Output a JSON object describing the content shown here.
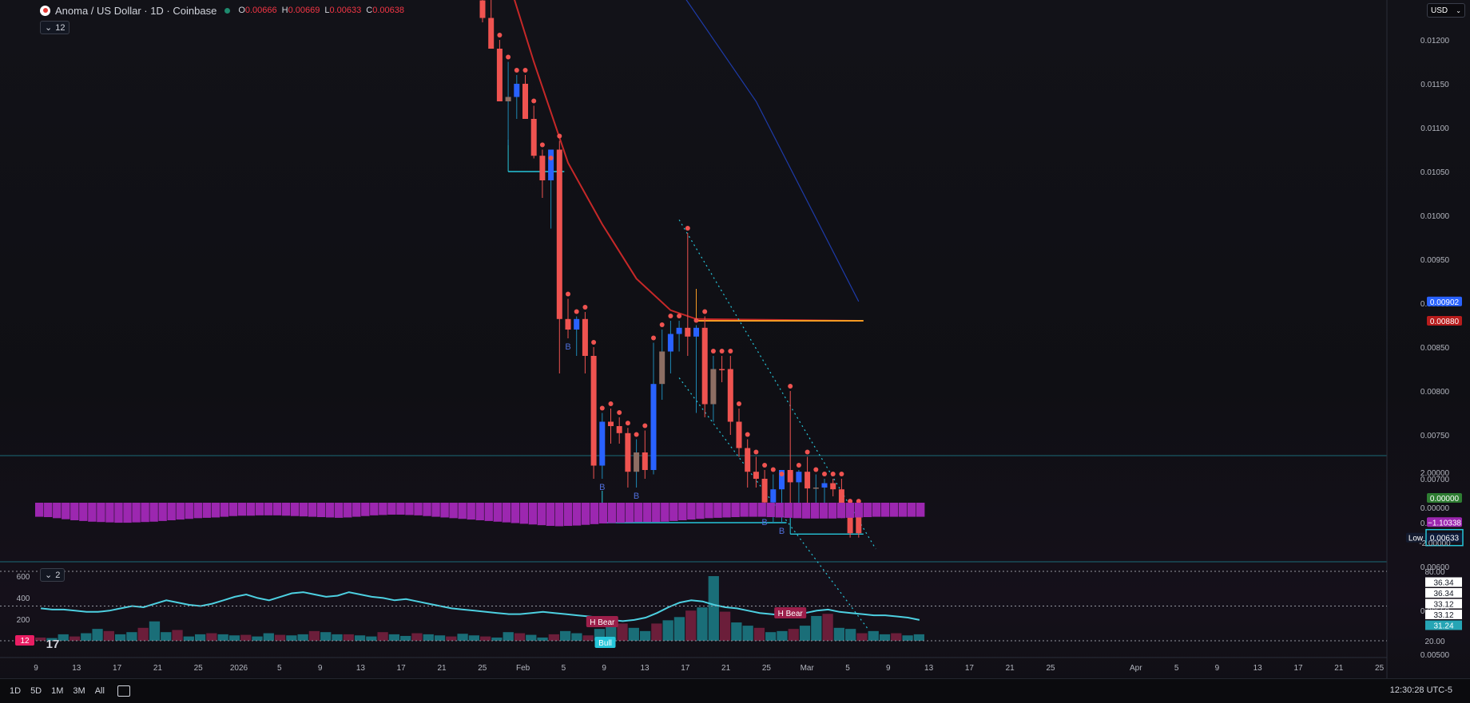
{
  "header": {
    "symbol": "Anoma / US Dollar · 1D · Coinbase",
    "ohlc": {
      "o_label": "O",
      "o": "0.00666",
      "h_label": "H",
      "h": "0.00669",
      "l_label": "L",
      "l": "0.00633",
      "c_label": "C",
      "c": "0.00638"
    },
    "indicator_count": "12",
    "volume_indicator_count": "2",
    "currency": "USD"
  },
  "colors": {
    "up": "#ef5350",
    "down": "#ef5350",
    "bull_fill": "#2962ff",
    "ema_red": "#c62828",
    "sma_blue": "#1e3ba8",
    "cyan": "#26c6da",
    "orange": "#f59a23",
    "hist": "#9c27b0",
    "vol_teal": "#1a6e78",
    "vol_red": "#6b1e3a"
  },
  "chart_data": [
    {
      "type": "line",
      "title": "",
      "series": [
        {
          "name": "",
          "kind": "candles",
          "x": [
            "Jan 22",
            "Jan 23",
            "Jan 24",
            "Jan 25",
            "Jan 26",
            "Jan 27",
            "Jan 28",
            "Jan 29",
            "Jan 30",
            "Jan 31",
            "Feb 1",
            "Feb 2",
            "Feb 3",
            "Feb 4",
            "Feb 5",
            "Feb 6",
            "Feb 7",
            "Feb 8",
            "Feb 9",
            "Feb 10",
            "Feb 11",
            "Feb 12",
            "Feb 13",
            "Feb 14",
            "Feb 15",
            "Feb 16",
            "Feb 17",
            "Feb 18",
            "Feb 19",
            "Feb 20",
            "Feb 21",
            "Feb 22",
            "Feb 23",
            "Feb 24",
            "Feb 25",
            "Feb 26",
            "Feb 27",
            "Feb 28",
            "Mar 1",
            "Mar 2",
            "Mar 3",
            "Mar 4",
            "Mar 5",
            "Mar 6",
            "Mar 7"
          ],
          "open": [
            0.01245,
            0.01225,
            0.0119,
            0.0113,
            0.01135,
            0.0115,
            0.0111,
            0.01068,
            0.0104,
            0.01075,
            0.00882,
            0.0087,
            0.00882,
            0.0084,
            0.00715,
            0.00765,
            0.0076,
            0.00752,
            0.00708,
            0.0073,
            0.0071,
            0.00808,
            0.00845,
            0.00865,
            0.00872,
            0.00862,
            0.00872,
            0.00785,
            0.00825,
            0.00825,
            0.00765,
            0.00735,
            0.00708,
            0.007,
            0.00673,
            0.00688,
            0.0071,
            0.00696,
            0.00708,
            0.00689,
            0.0069,
            0.00695,
            0.00688,
            0.00666,
            0.00666
          ],
          "high": [
            0.01265,
            0.0125,
            0.012,
            0.01175,
            0.0116,
            0.0116,
            0.01125,
            0.01075,
            0.0106,
            0.01085,
            0.00905,
            0.00885,
            0.0089,
            0.0085,
            0.00775,
            0.0078,
            0.0077,
            0.00758,
            0.00745,
            0.00755,
            0.00855,
            0.0087,
            0.0088,
            0.0088,
            0.0098,
            0.00875,
            0.00885,
            0.0084,
            0.0084,
            0.0084,
            0.0078,
            0.00745,
            0.00725,
            0.0071,
            0.00705,
            0.007,
            0.008,
            0.0071,
            0.00725,
            0.00705,
            0.007,
            0.007,
            0.007,
            0.00669,
            0.00669
          ],
          "low": [
            0.0122,
            0.01195,
            0.01135,
            0.0108,
            0.0111,
            0.0112,
            0.01065,
            0.0102,
            0.00985,
            0.0082,
            0.0086,
            0.0084,
            0.0082,
            0.007,
            0.007,
            0.0074,
            0.0074,
            0.0069,
            0.0069,
            0.007,
            0.00705,
            0.0079,
            0.0082,
            0.00845,
            0.0084,
            0.00775,
            0.0077,
            0.00765,
            0.0081,
            0.0075,
            0.00725,
            0.0069,
            0.0069,
            0.0066,
            0.0065,
            0.0065,
            0.00672,
            0.0067,
            0.0066,
            0.00655,
            0.0067,
            0.0068,
            0.00655,
            0.00633,
            0.00633
          ],
          "close": [
            0.01225,
            0.0119,
            0.0113,
            0.01135,
            0.0115,
            0.0111,
            0.01068,
            0.0104,
            0.01075,
            0.00882,
            0.0087,
            0.00882,
            0.0084,
            0.00715,
            0.00765,
            0.0076,
            0.00752,
            0.00708,
            0.0073,
            0.0071,
            0.00808,
            0.00845,
            0.00865,
            0.00872,
            0.00862,
            0.00872,
            0.00785,
            0.00825,
            0.00825,
            0.00765,
            0.00735,
            0.00708,
            0.007,
            0.00673,
            0.00688,
            0.0071,
            0.00696,
            0.00708,
            0.00689,
            0.0069,
            0.00695,
            0.00688,
            0.00666,
            0.00638,
            0.00638
          ]
        },
        {
          "name": "",
          "kind": "ema",
          "points": [
            [
              "Jan 24",
              0.013
            ],
            [
              "Jan 28",
              0.01175
            ],
            [
              "Feb 1",
              0.0106
            ],
            [
              "Feb 5",
              0.0099
            ],
            [
              "Feb 9",
              0.00928
            ],
            [
              "Feb 13",
              0.00892
            ],
            [
              "Feb 16",
              0.00882
            ],
            [
              "Mar 7",
              0.0088
            ]
          ]
        },
        {
          "name": "",
          "kind": "sma",
          "points": [
            [
              "Feb 11",
              0.013
            ],
            [
              "Feb 23",
              0.0113
            ],
            [
              "Mar 7",
              0.00902
            ]
          ]
        }
      ],
      "price_axis": [
        "0.01200",
        "0.01150",
        "0.01100",
        "0.01050",
        "0.01000",
        "0.00950",
        "0.00900",
        "0.00850",
        "0.00800",
        "0.00750",
        "0.00700",
        "0.00650",
        "0.00600",
        "0.00550",
        "0.00500"
      ],
      "price_tags": [
        {
          "value": "0.00902",
          "color": "#2962ff"
        },
        {
          "value": "0.00880",
          "color": "#b71c1c"
        },
        {
          "value": "0.00633",
          "color": "#0d1b3a",
          "label": "Low"
        }
      ],
      "signals": [
        {
          "x": "Feb 1",
          "text": "B"
        },
        {
          "x": "Feb 5",
          "text": "B"
        },
        {
          "x": "Feb 9",
          "text": "B"
        },
        {
          "x": "Feb 24",
          "text": "B"
        },
        {
          "x": "Feb 26",
          "text": "B"
        }
      ],
      "levels": [
        {
          "from": "Jan 25",
          "to": "Jan 31",
          "y": 0.0105,
          "color": "#26c6da"
        },
        {
          "from": "Feb 5",
          "to": "Feb 26",
          "y": 0.0065,
          "color": "#26c6da"
        },
        {
          "from": "Feb 27",
          "to": "Mar 7",
          "y": 0.00637,
          "color": "#26c6da"
        },
        {
          "from": "Feb 16",
          "to": "Mar 7",
          "y": 0.0088,
          "color": "#f59a23"
        }
      ],
      "channel": {
        "upper": [
          [
            "Feb 14",
            0.00995
          ],
          [
            "Mar 9",
            0.0062
          ]
        ],
        "lower": [
          [
            "Feb 14",
            0.00815
          ],
          [
            "Mar 8",
            0.0053
          ]
        ]
      }
    },
    {
      "type": "bar",
      "title": "",
      "yaxis": [
        "2.00000",
        "0.00000",
        "-2.00000"
      ],
      "tags": [
        {
          "value": "0.00000",
          "color": "#2e7d32"
        },
        {
          "value": "−1.10338",
          "color": "#9c27b0"
        }
      ],
      "values": [
        -0.8,
        -0.82,
        -0.88,
        -0.94,
        -1.0,
        -1.04,
        -1.08,
        -1.1,
        -1.12,
        -1.14,
        -1.14,
        -1.12,
        -1.1,
        -1.08,
        -1.04,
        -1.0,
        -0.96,
        -0.92,
        -0.88,
        -0.86,
        -0.84,
        -0.8,
        -0.76,
        -0.74,
        -0.74,
        -0.72,
        -0.72,
        -0.72,
        -0.74,
        -0.76,
        -0.78,
        -0.8,
        -0.82,
        -0.84,
        -0.86,
        -0.84,
        -0.8,
        -0.76,
        -0.72,
        -0.7,
        -0.68,
        -0.68,
        -0.7,
        -0.72,
        -0.76,
        -0.8,
        -0.84,
        -0.88,
        -0.92,
        -0.96,
        -1.0,
        -1.04,
        -1.08,
        -1.12,
        -1.16,
        -1.2,
        -1.24,
        -1.28,
        -1.32,
        -1.34,
        -1.32,
        -1.3,
        -1.26,
        -1.22,
        -1.18,
        -1.16,
        -1.14,
        -1.12,
        -1.1,
        -1.1,
        -1.1,
        -1.08,
        -1.04,
        -1.0,
        -0.96,
        -0.92,
        -0.88,
        -0.86,
        -0.84,
        -0.82,
        -0.8,
        -0.8,
        -0.8,
        -0.82,
        -0.84,
        -0.86,
        -0.88,
        -0.9,
        -0.9,
        -0.9,
        -0.9,
        -0.88,
        -0.86,
        -0.84,
        -0.82,
        -0.8,
        -0.8,
        -0.8,
        -0.8,
        -0.8,
        -0.8
      ]
    },
    {
      "type": "bar",
      "title": "",
      "left_axis": [
        "600",
        "400",
        "200"
      ],
      "right_axis": [
        "80.00",
        "36.34",
        "36.34",
        "33.12",
        "33.12",
        "31.24",
        "20.00"
      ],
      "labels": [
        {
          "x": "Feb 5",
          "text": "H Bear"
        },
        {
          "x": "Feb 6",
          "text": "Bull"
        },
        {
          "x": "Feb 27",
          "text": "H Bear"
        }
      ],
      "volume": [
        30,
        25,
        60,
        40,
        70,
        110,
        90,
        60,
        80,
        120,
        180,
        80,
        100,
        40,
        60,
        70,
        60,
        50,
        55,
        40,
        70,
        55,
        50,
        60,
        90,
        80,
        60,
        60,
        50,
        40,
        80,
        60,
        45,
        70,
        60,
        50,
        40,
        65,
        50,
        40,
        30,
        80,
        70,
        55,
        30,
        60,
        90,
        70,
        50,
        110,
        140,
        160,
        120,
        90,
        160,
        190,
        220,
        280,
        310,
        600,
        270,
        170,
        140,
        120,
        80,
        90,
        110,
        140,
        230,
        250,
        120,
        110,
        70,
        90,
        60,
        70,
        50,
        60
      ],
      "rsi": [
        48,
        47,
        47,
        46,
        45,
        45,
        46,
        48,
        50,
        49,
        52,
        55,
        53,
        51,
        50,
        52,
        55,
        58,
        60,
        57,
        55,
        58,
        61,
        62,
        60,
        58,
        59,
        62,
        60,
        58,
        57,
        55,
        56,
        54,
        52,
        50,
        48,
        47,
        46,
        45,
        44,
        43,
        43,
        44,
        45,
        44,
        43,
        42,
        41,
        40,
        38,
        37,
        38,
        40,
        44,
        49,
        53,
        55,
        54,
        51,
        49,
        48,
        46,
        44,
        43,
        42,
        42,
        44,
        46,
        47,
        45,
        44,
        43,
        42,
        42,
        41,
        40,
        38
      ],
      "channels": [
        "80.00",
        "20.00"
      ]
    }
  ],
  "xaxis": {
    "ticks": [
      "9",
      "13",
      "17",
      "21",
      "25",
      "2026",
      "5",
      "9",
      "13",
      "17",
      "21",
      "25",
      "Feb",
      "5",
      "9",
      "13",
      "17",
      "21",
      "25",
      "Mar",
      "5",
      "9",
      "13",
      "17",
      "21",
      "25",
      "Apr",
      "5",
      "9",
      "13",
      "17",
      "21",
      "25"
    ]
  },
  "toolbar": {
    "ranges": [
      "1D",
      "5D",
      "1M",
      "3M",
      "All"
    ],
    "clock": "12:30:28 UTC-5"
  },
  "overlay_marks": {
    "tv_logo": "17",
    "badge": "12"
  }
}
